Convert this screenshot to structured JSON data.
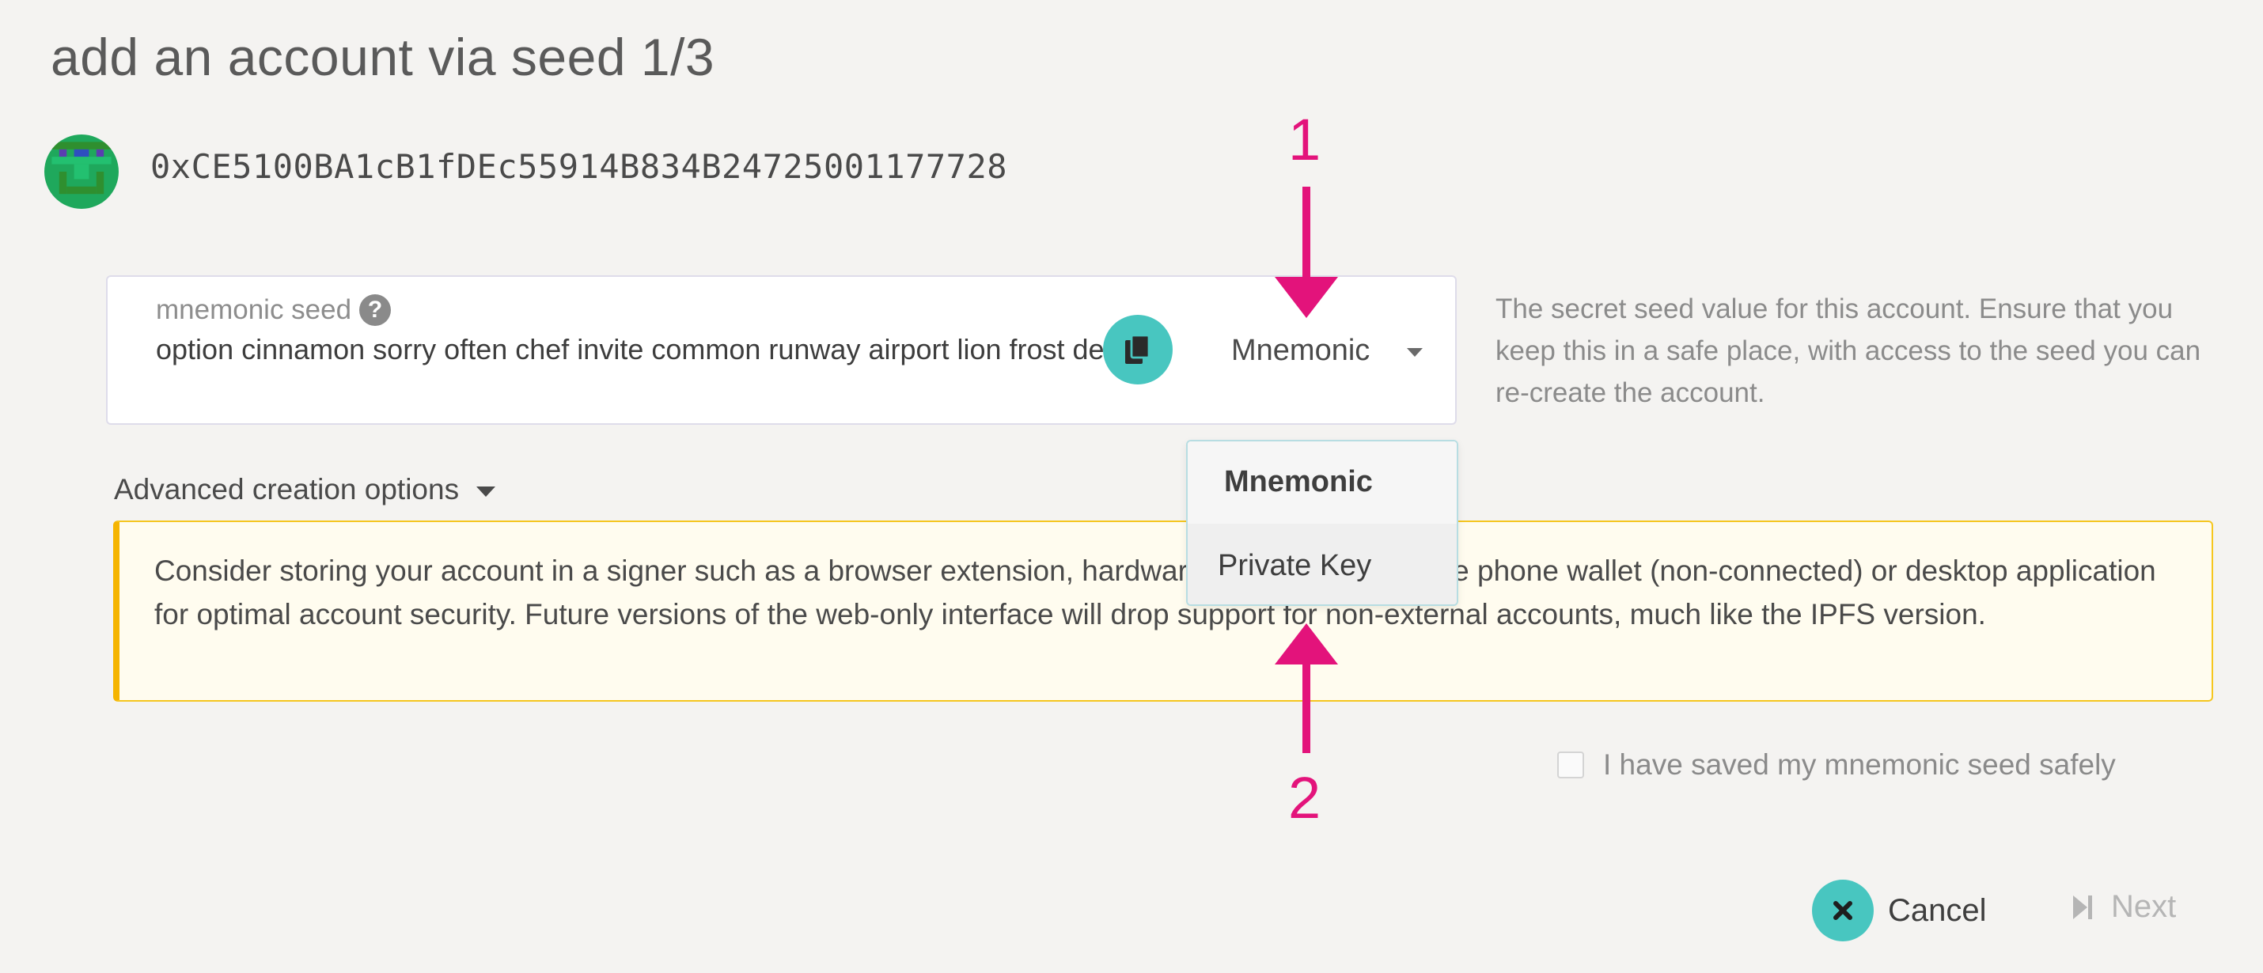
{
  "page": {
    "title": "add an account via seed 1/3"
  },
  "account": {
    "address": "0xCE5100BA1cB1fDEc55914B834B24725001177728"
  },
  "seed_input": {
    "label": "mnemonic seed",
    "value": "option cinnamon sorry often chef invite common runway airport lion frost demise",
    "type_selected": "Mnemonic",
    "help_text": "The secret seed value for this account. Ensure that you keep this in a safe place, with access to the seed you can re-create the account."
  },
  "seed_type_menu": {
    "options": [
      "Mnemonic",
      "Private Key"
    ]
  },
  "advanced": {
    "label": "Advanced creation options"
  },
  "warning": {
    "text": "Consider storing your account in a signer such as a browser extension, hardware device, QR-capable phone wallet (non-connected) or desktop application for optimal account security. Future versions of the web-only interface will drop support for non-external accounts, much like the IPFS version."
  },
  "confirm": {
    "label": "I have saved my mnemonic seed safely",
    "checked": false
  },
  "buttons": {
    "cancel": "Cancel",
    "next": "Next"
  },
  "annotations": {
    "arrow_1": "1",
    "arrow_2": "2"
  },
  "colors": {
    "accent": "#48c6c0",
    "warning_border": "#f5b400",
    "annotation": "#e3137b"
  },
  "icons": [
    "help-icon",
    "copy-icon",
    "chevron-down-icon",
    "close-icon",
    "step-forward-icon"
  ]
}
